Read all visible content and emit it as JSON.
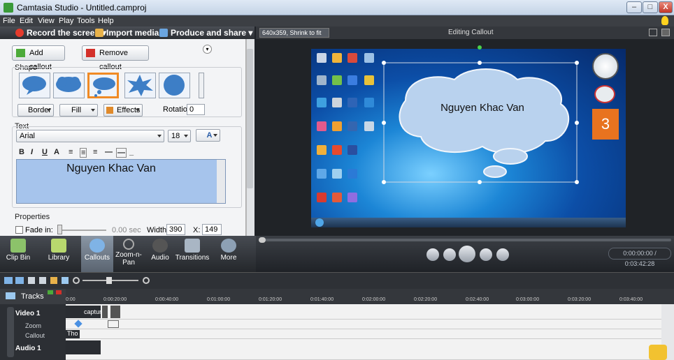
{
  "window": {
    "title": "Camtasia Studio - Untitled.camproj",
    "minimize": "–",
    "maximize": "□",
    "close": "X"
  },
  "menu": [
    "File",
    "Edit",
    "View",
    "Play",
    "Tools",
    "Help"
  ],
  "toolbar": {
    "record": "Record the screen",
    "import": "Import media",
    "produce": "Produce and share"
  },
  "callout_panel": {
    "add": "Add callout",
    "remove": "Remove callout",
    "shape_label": "Shape",
    "border": "Border",
    "fill": "Fill",
    "effects": "Effects",
    "rotation_label": "Rotation:",
    "rotation_value": "0",
    "text_label": "Text",
    "font": "Arial",
    "font_size": "18",
    "font_color_glyph": "A",
    "format_buttons": [
      "B",
      "I",
      "U",
      "A",
      "≡",
      "≡",
      "≡",
      "—",
      "—",
      "_"
    ],
    "text_value": "Nguyen Khac Van",
    "properties_label": "Properties",
    "fadein_label": "Fade in:",
    "fadein_value": "0.00 sec",
    "width_label": "Width:",
    "width_value": "390",
    "x_label": "X:",
    "x_value": "149"
  },
  "canvas": {
    "zoom": "640x359, Shrink to fit",
    "title": "Editing Callout",
    "callout_text": "Nguyen Khac Van",
    "calendar_day": "3"
  },
  "tabs": [
    "Clip Bin",
    "Library",
    "Callouts",
    "Zoom-n-Pan",
    "Audio",
    "Transitions",
    "More"
  ],
  "timecode": "0:00:00:00 / 0:03:42:28",
  "timeline": {
    "tracks_label": "Tracks",
    "ticks": [
      "0:00",
      "0:00:20:00",
      "0:00:40:00",
      "0:01:00:00",
      "0:01:20:00",
      "0:01:40:00",
      "0:02:00:00",
      "0:02:20:00",
      "0:02:40:00",
      "0:03:00:00",
      "0:03:20:00",
      "0:03:40:00"
    ],
    "tracks": [
      "Video 1",
      "Zoom",
      "Callout",
      "Audio 1"
    ],
    "clip_video": "captur",
    "clip_callout": "Tho"
  },
  "colors": {
    "accent": "#f08a24",
    "selection": "#a6c4ec",
    "dark": "#2e3136"
  }
}
